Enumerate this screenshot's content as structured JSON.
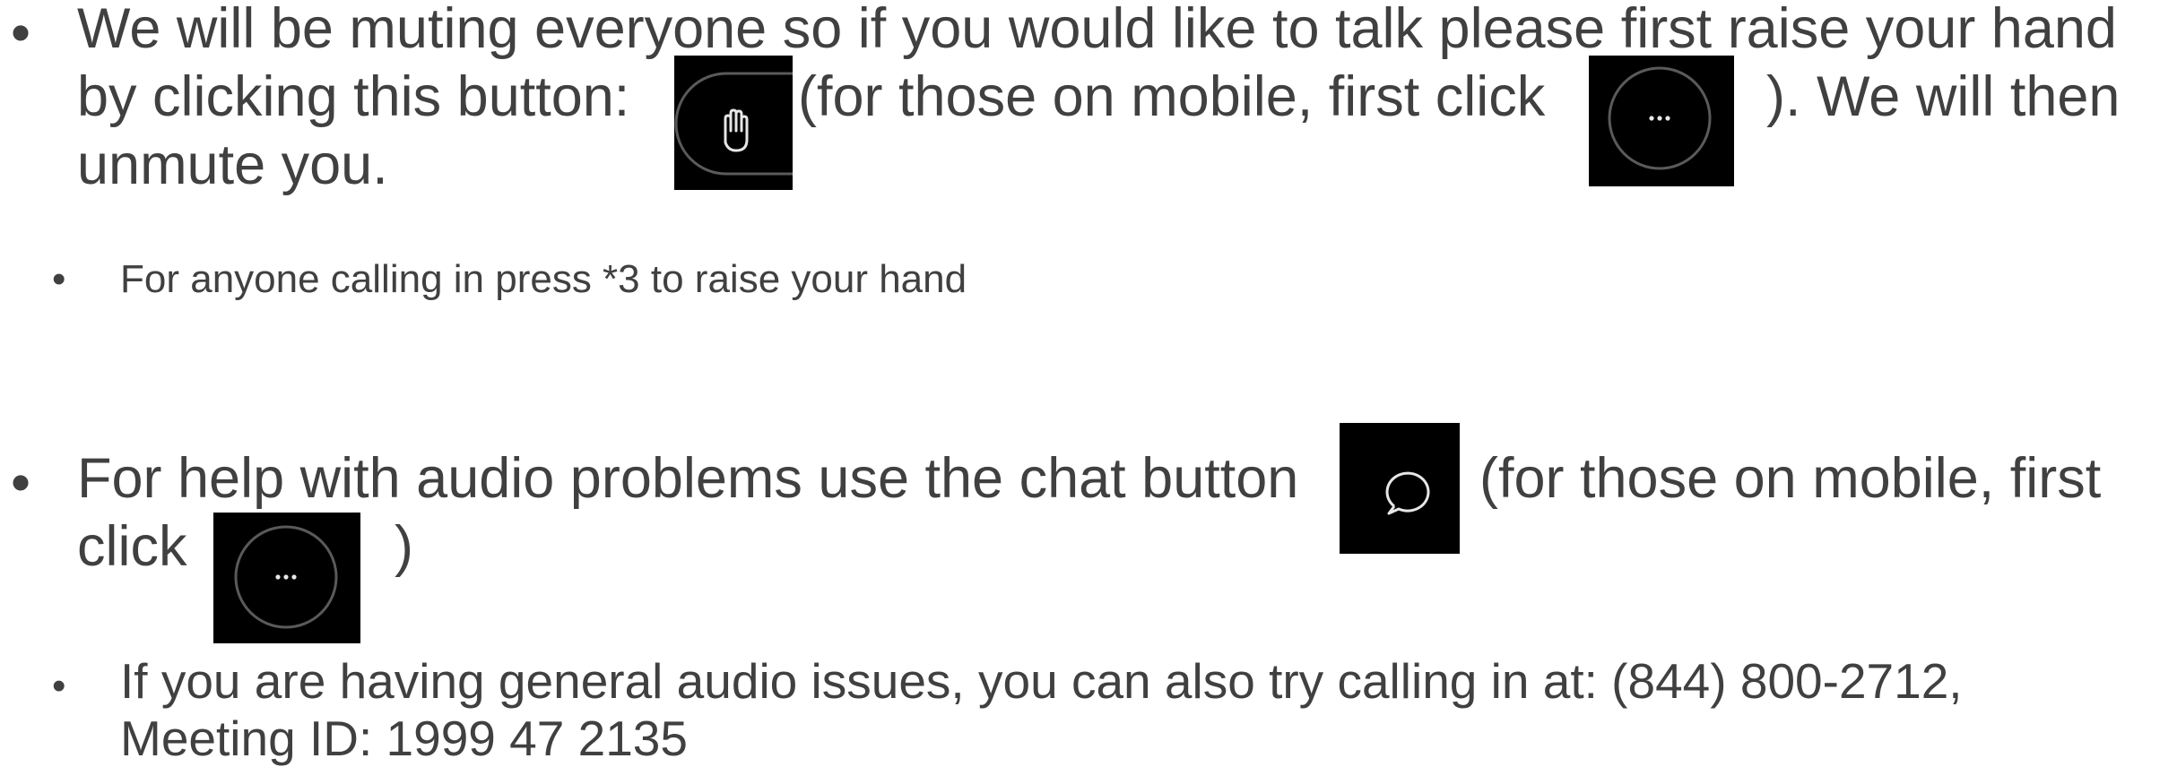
{
  "bullet_glyph": "•",
  "item1": {
    "line1": "We will be muting everyone so if you would like to talk please first raise your hand",
    "line2_before": "by clicking this button:",
    "line2_middle": "(for those on mobile, first click",
    "line2_after": "). We will then",
    "line3": "unmute you.",
    "sub": "For anyone calling in press *3 to raise your hand"
  },
  "item2": {
    "line1_before": "For help with audio problems use the chat button",
    "line1_after": "(for those on mobile, first",
    "line2_before": "click",
    "line2_after": ")",
    "sub_line1": "If you are having general audio issues, you can also try calling in at: (844) 800-2712,",
    "sub_line2": "Meeting ID: 1999 47 2135"
  },
  "icons": {
    "raise_hand": "raise-hand-icon",
    "more_options": "more-options-icon",
    "chat": "chat-bubble-icon"
  },
  "colors": {
    "text": "#404040",
    "icon_background": "#000000",
    "icon_outline": "#5a5a5a",
    "icon_glyph": "#e6e6e6"
  }
}
